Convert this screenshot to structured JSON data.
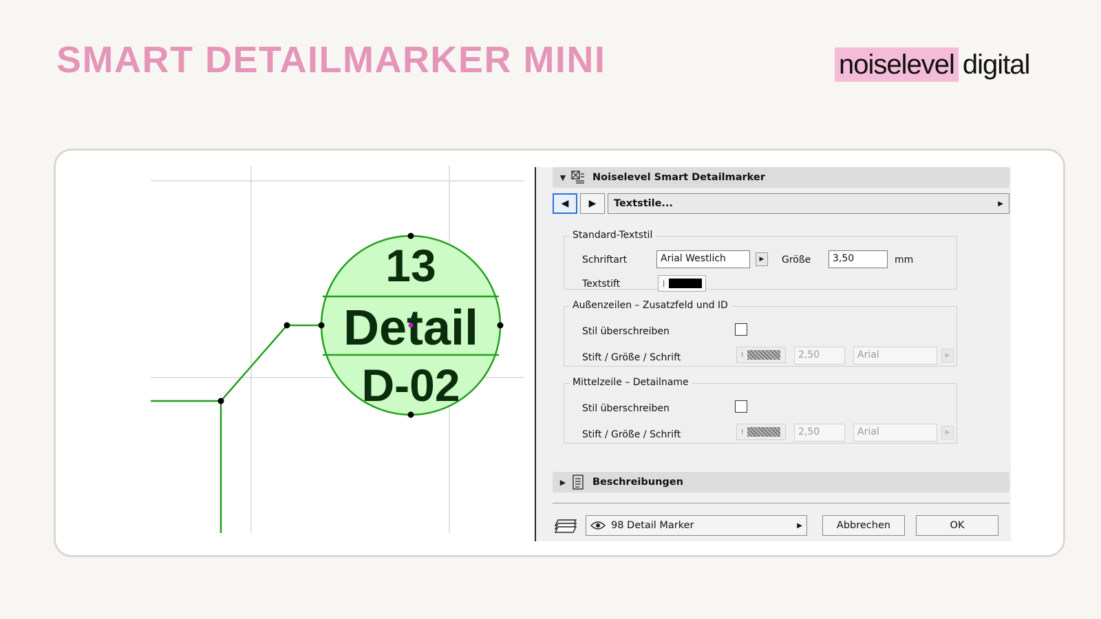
{
  "slide": {
    "title": "SMART DETAILMARKER MINI",
    "title_color": "#e596b8"
  },
  "brand": {
    "highlight": "noiselevel",
    "rest": "digital",
    "highlight_color": "#f4bcd8"
  },
  "marker": {
    "top_text": "13",
    "middle_text": "Detail",
    "bottom_text": "D-02",
    "fill_color": "#ccfbc6",
    "line_color": "#22a01a",
    "text_color": "#0b2d0b"
  },
  "dialog": {
    "panel_title": "Noiselevel Smart Detailmarker",
    "panel_icon": "detailmarker-icon",
    "nav_prev_icon": "triangle-left-icon",
    "nav_next_icon": "triangle-right-icon",
    "page_select": "Textstile...",
    "standard": {
      "title": "Standard-Textstil",
      "font_label": "Schriftart",
      "font_value": "Arial Westlich",
      "size_label": "Größe",
      "size_value": "3,50",
      "size_unit": "mm",
      "pen_label": "Textstift"
    },
    "outer": {
      "title": "Außenzeilen – Zusatzfeld und ID",
      "override_label": "Stil überschreiben",
      "override_checked": false,
      "pen_size_font_label": "Stift / Größe / Schrift",
      "size_value": "2,50",
      "font_value": "Arial"
    },
    "middle": {
      "title": "Mittelzeile – Detailname",
      "override_label": "Stil überschreiben",
      "override_checked": false,
      "pen_size_font_label": "Stift / Größe / Schrift",
      "size_value": "2,50",
      "font_value": "Arial"
    },
    "descriptions_title": "Beschreibungen",
    "descriptions_icon": "document-list-icon",
    "footer": {
      "layer_icon": "layers-icon",
      "visibility_icon": "eye-icon",
      "layer_value": "98 Detail Marker",
      "cancel_label": "Abbrechen",
      "ok_label": "OK"
    }
  }
}
